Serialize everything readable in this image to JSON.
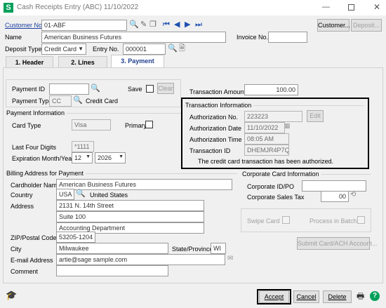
{
  "window": {
    "title": "Cash Receipts Entry (ABC) 11/10/2022",
    "app_icon": "sage-s-icon",
    "accent": "#00a05a"
  },
  "header": {
    "customer_no_label": "Customer No.",
    "customer_no_value": "01-ABF",
    "customer_button": "Customer...",
    "deposit_button": "Deposit...",
    "name_label": "Name",
    "name_value": "American Business Futures",
    "invoice_no_label": "Invoice No.",
    "invoice_no_value": "",
    "deposit_type_label": "Deposit Type",
    "deposit_type_value": "Credit Card",
    "entry_no_label": "Entry No.",
    "entry_no_value": "000001"
  },
  "tabs": [
    {
      "label": "1. Header"
    },
    {
      "label": "2. Lines"
    },
    {
      "label": "3. Payment"
    }
  ],
  "payment": {
    "payment_id_label": "Payment ID",
    "payment_id_value": "",
    "save_label": "Save",
    "clear_button": "Clear",
    "payment_type_label": "Payment Type",
    "payment_type_value": "CC",
    "payment_type_desc": "Credit Card",
    "transaction_amount_label": "Transaction Amount",
    "transaction_amount_value": "100.00"
  },
  "payment_info": {
    "title": "Payment Information",
    "card_type_label": "Card Type",
    "card_type_value": "Visa",
    "primary_label": "Primary",
    "last_four_label": "Last Four Digits",
    "last_four_value": "*1111",
    "expiration_label": "Expiration Month/Year",
    "exp_month": "12",
    "exp_year": "2026"
  },
  "transaction_info": {
    "title": "Transaction Information",
    "auth_no_label": "Authorization No.",
    "auth_no_value": "223223",
    "edit_button": "Edit",
    "auth_date_label": "Authorization Date",
    "auth_date_value": "11/10/2022",
    "auth_time_label": "Authorization Time",
    "auth_time_value": "08:05 AM",
    "transaction_id_label": "Transaction ID",
    "transaction_id_value": "DHEMJR4P7Q",
    "message": "The credit card transaction has been authorized."
  },
  "billing": {
    "title": "Billing Address for Payment",
    "cardholder_label": "Cardholder Name",
    "cardholder_value": "American Business Futures",
    "country_label": "Country",
    "country_code": "USA",
    "country_name": "United States",
    "address_label": "Address",
    "address_line1": "2131 N. 14th Street",
    "address_line2": "Suite 100",
    "address_line3": "Accounting Department",
    "zip_label": "ZIP/Postal Code",
    "zip_value": "53205-1204",
    "city_label": "City",
    "city_value": "Milwaukee",
    "state_label": "State/Province",
    "state_value": "WI",
    "email_label": "E-mail Address",
    "email_value": "artie@sage sample.com",
    "comment_label": "Comment",
    "comment_value": ""
  },
  "corporate": {
    "title": "Corporate Card Information",
    "id_po_label": "Corporate ID/PO",
    "id_po_value": "",
    "sales_tax_label": "Corporate Sales Tax",
    "sales_tax_value": "00"
  },
  "swipe": {
    "swipe_card_label": "Swipe Card",
    "process_batch_label": "Process in Batch",
    "submit_button": "Submit Card/ACH Account..."
  },
  "footer": {
    "accept": "Accept",
    "cancel": "Cancel",
    "delete": "Delete"
  }
}
